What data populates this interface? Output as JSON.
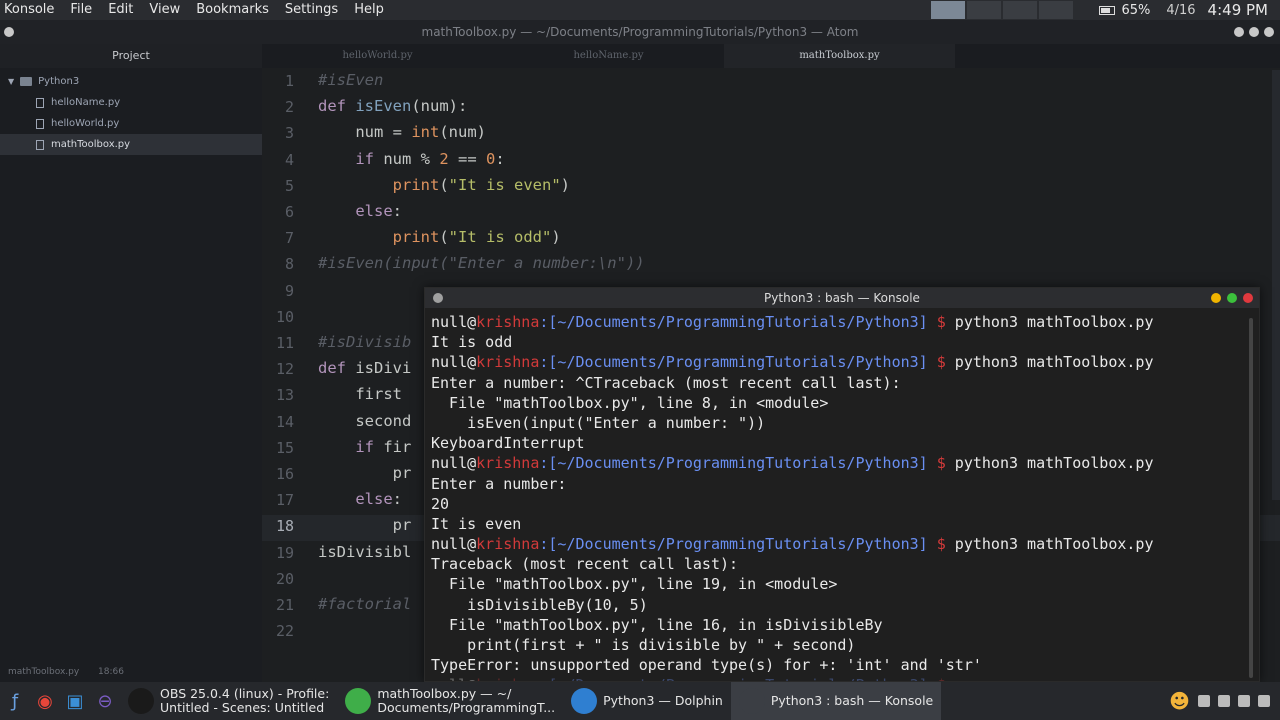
{
  "topbar": {
    "menus": [
      "Konsole",
      "File",
      "Edit",
      "View",
      "Bookmarks",
      "Settings",
      "Help"
    ],
    "battery": "65%",
    "date": "4/16",
    "time": "4:49 PM"
  },
  "atom": {
    "window_title": "mathToolbox.py — ~/Documents/ProgrammingTutorials/Python3 — Atom",
    "tree_header": "Project",
    "tree_root": "Python3",
    "tree_files": [
      "helloName.py",
      "helloWorld.py",
      "mathToolbox.py"
    ],
    "selected_file": "mathToolbox.py",
    "tabs": [
      "helloWorld.py",
      "helloName.py",
      "mathToolbox.py"
    ],
    "active_tab": "mathToolbox.py",
    "status_file": "mathToolbox.py",
    "status_pos": "18:66",
    "current_line": "18",
    "line_numbers": [
      "1",
      "2",
      "3",
      "4",
      "5",
      "6",
      "7",
      "8",
      "9",
      "10",
      "11",
      "12",
      "13",
      "14",
      "15",
      "16",
      "17",
      "18",
      "19",
      "20",
      "21",
      "22"
    ]
  },
  "code": [
    "#isEven",
    "def isEven(num):",
    "    num = int(num)",
    "    if num % 2 == 0:",
    "        print(\"It is even\")",
    "    else:",
    "        print(\"It is odd\")",
    "#isEven(input(\"Enter a number:\\n\"))",
    "",
    "",
    "#isDivisib",
    "def isDivi",
    "    first ",
    "    second",
    "    if fir",
    "        pr",
    "    else: ",
    "        pr",
    "isDivisibl",
    "",
    "#factorial",
    ""
  ],
  "konsole": {
    "title": "Python3 : bash — Konsole",
    "prompt_user": "null@",
    "prompt_host": "krishna",
    "prompt_path": ":[~/Documents/ProgrammingTutorials/Python3]",
    "prompt_dollar": "$",
    "command": "python3 mathToolbox.py",
    "blocks": [
      [
        "It is odd"
      ],
      [
        "Enter a number: ^CTraceback (most recent call last):",
        "  File \"mathToolbox.py\", line 8, in <module>",
        "    isEven(input(\"Enter a number: \"))",
        "KeyboardInterrupt"
      ],
      [
        "Enter a number:",
        "20",
        "It is even"
      ],
      [
        "Traceback (most recent call last):",
        "  File \"mathToolbox.py\", line 19, in <module>",
        "    isDivisibleBy(10, 5)",
        "  File \"mathToolbox.py\", line 16, in isDivisibleBy",
        "    print(first + \" is divisible by \" + second)",
        "TypeError: unsupported operand type(s) for +: 'int' and 'str'"
      ]
    ]
  },
  "taskbar": {
    "tasks": [
      {
        "label": "OBS 25.0.4 (linux) - Profile: Untitled - Scenes: Untitled",
        "line1": "OBS 25.0.4 (linux) - Profile:",
        "line2": "Untitled - Scenes: Untitled",
        "color": "#1a1a1a"
      },
      {
        "label": "mathToolbox.py — ~/Documents/ProgrammingT...",
        "line1": "mathToolbox.py — ~/",
        "line2": "Documents/ProgrammingT...",
        "color": "#3fae49"
      },
      {
        "label": "Python3 — Dolphin",
        "line1": "Python3 — Dolphin",
        "line2": "",
        "color": "#2f7fd1"
      },
      {
        "label": "Python3 : bash — Konsole",
        "line1": "Python3 : bash — Konsole",
        "line2": "",
        "color": "#3b3e44"
      }
    ]
  },
  "colors": {
    "keyword": "#b294bb",
    "function": "#81a2be",
    "builtin": "#de935f",
    "string": "#b5bd68",
    "comment": "#5a5e66",
    "number": "#de935f"
  }
}
